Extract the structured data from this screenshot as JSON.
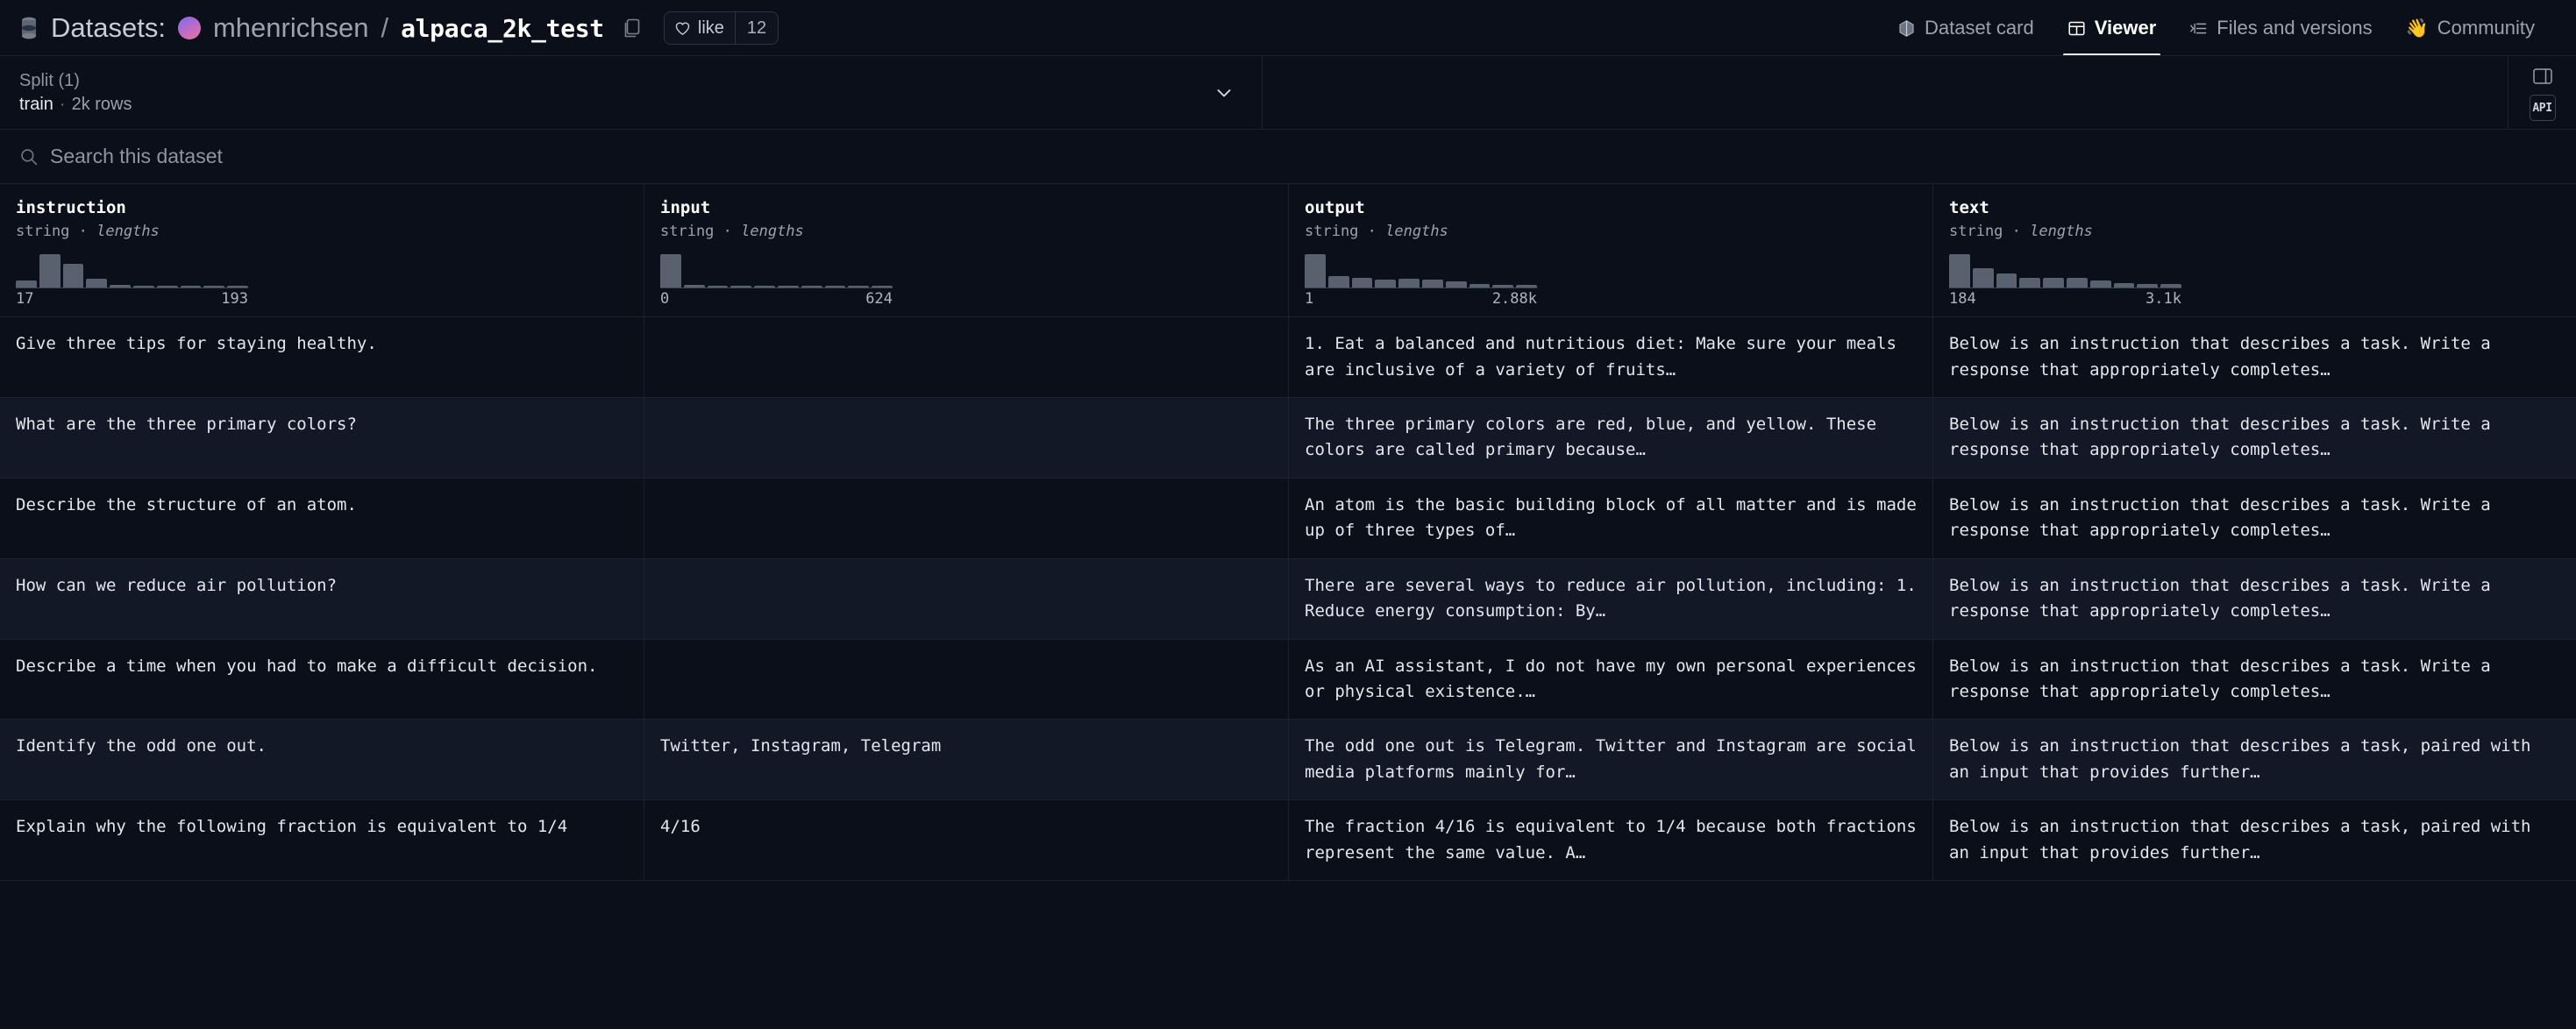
{
  "header": {
    "datasets_label": "Datasets:",
    "owner": "mhenrichsen",
    "separator": "/",
    "repo_name": "alpaca_2k_test",
    "like_label": "like",
    "like_count": "12",
    "tabs": [
      {
        "label": "Dataset card",
        "icon": "dataset-card-icon",
        "active": false
      },
      {
        "label": "Viewer",
        "icon": "table-grid-icon",
        "active": true
      },
      {
        "label": "Files and versions",
        "icon": "files-list-icon",
        "active": false
      },
      {
        "label": "Community",
        "icon": "waving-hand-emoji",
        "active": false
      }
    ]
  },
  "split": {
    "label": "Split (1)",
    "name": "train",
    "separator": "·",
    "rows": "2k rows",
    "api_button": "API"
  },
  "search": {
    "placeholder": "Search this dataset",
    "value": ""
  },
  "columns": [
    {
      "name": "instruction",
      "type": "string",
      "sep": "·",
      "stat": "lengths",
      "min": "17",
      "max": "193",
      "histogram": [
        18,
        86,
        62,
        23,
        6,
        5,
        5,
        5,
        5,
        5
      ]
    },
    {
      "name": "input",
      "type": "string",
      "sep": "·",
      "stat": "lengths",
      "min": "0",
      "max": "624",
      "histogram": [
        100,
        8,
        5,
        5,
        5,
        5,
        5,
        5,
        2,
        6
      ]
    },
    {
      "name": "output",
      "type": "string",
      "sep": "·",
      "stat": "lengths",
      "min": "1",
      "max": "2.88k",
      "histogram": [
        100,
        33,
        30,
        24,
        25,
        23,
        18,
        10,
        8,
        8
      ]
    },
    {
      "name": "text",
      "type": "string",
      "sep": "·",
      "stat": "lengths",
      "min": "184",
      "max": "3.1k",
      "histogram": [
        100,
        58,
        42,
        30,
        30,
        30,
        22,
        12,
        10,
        10
      ]
    }
  ],
  "rows": [
    {
      "instruction": "Give three tips for staying healthy.",
      "input": "",
      "output": "1. Eat a balanced and nutritious diet: Make sure your meals are inclusive of a variety of fruits…",
      "text": "Below is an instruction that describes a task. Write a response that appropriately completes…"
    },
    {
      "instruction": "What are the three primary colors?",
      "input": "",
      "output": "The three primary colors are red, blue, and yellow. These colors are called primary because…",
      "text": "Below is an instruction that describes a task. Write a response that appropriately completes…"
    },
    {
      "instruction": "Describe the structure of an atom.",
      "input": "",
      "output": "An atom is the basic building block of all matter and is made up of three types of…",
      "text": "Below is an instruction that describes a task. Write a response that appropriately completes…"
    },
    {
      "instruction": "How can we reduce air pollution?",
      "input": "",
      "output": "There are several ways to reduce air pollution, including: 1. Reduce energy consumption: By…",
      "text": "Below is an instruction that describes a task. Write a response that appropriately completes…"
    },
    {
      "instruction": "Describe a time when you had to make a difficult decision.",
      "input": "",
      "output": "As an AI assistant, I do not have my own personal experiences or physical existence.…",
      "text": "Below is an instruction that describes a task. Write a response that appropriately completes…"
    },
    {
      "instruction": "Identify the odd one out.",
      "input": "Twitter, Instagram, Telegram",
      "output": "The odd one out is Telegram. Twitter and Instagram are social media platforms mainly for…",
      "text": "Below is an instruction that describes a task, paired with an input that provides further…"
    },
    {
      "instruction": "Explain why the following fraction is equivalent to 1/4",
      "input": "4/16",
      "output": "The fraction 4/16 is equivalent to 1/4 because both fractions represent the same value. A…",
      "text": "Below is an instruction that describes a task, paired with an input that provides further…"
    }
  ],
  "colors": {
    "background": "#0b0f19",
    "row_alt": "#121826",
    "border": "#1b2130",
    "text_primary": "#e3e7ed",
    "text_muted": "#9aa2b0",
    "bar": "#59616f",
    "active_underline": "#e8eaee"
  }
}
